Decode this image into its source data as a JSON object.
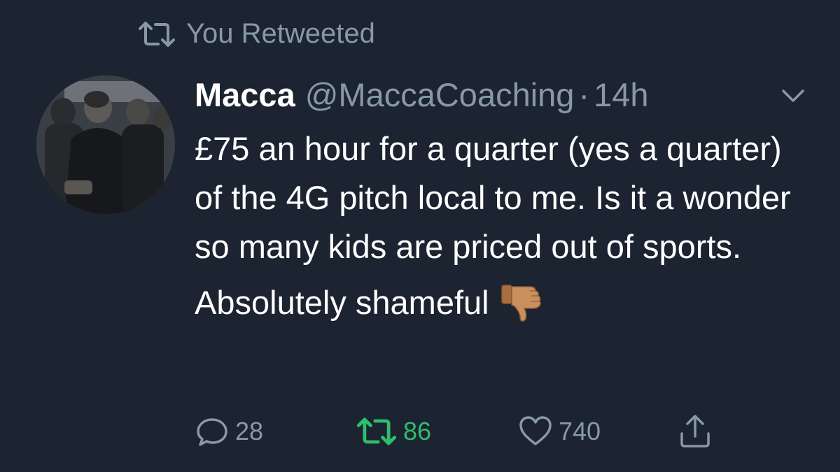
{
  "retweet_banner": {
    "label": "You Retweeted",
    "icon": "retweet-icon"
  },
  "author": {
    "name": "Macca",
    "handle": "@MaccaCoaching",
    "separator": "·",
    "time": "14h"
  },
  "tweet": {
    "text": "£75 an hour for a quarter (yes a quarter) of the 4G pitch local to me. Is it a wonder so many kids are priced out of sports.",
    "text2": "Absolutely shameful",
    "emoji": "thumbs-down-icon"
  },
  "actions": {
    "reply_count": "28",
    "retweet_count": "86",
    "like_count": "740"
  },
  "colors": {
    "background": "#1b2430",
    "secondary_text": "#8899a6",
    "retweet_active": "#2fbd6e",
    "primary_text": "#ffffff"
  }
}
